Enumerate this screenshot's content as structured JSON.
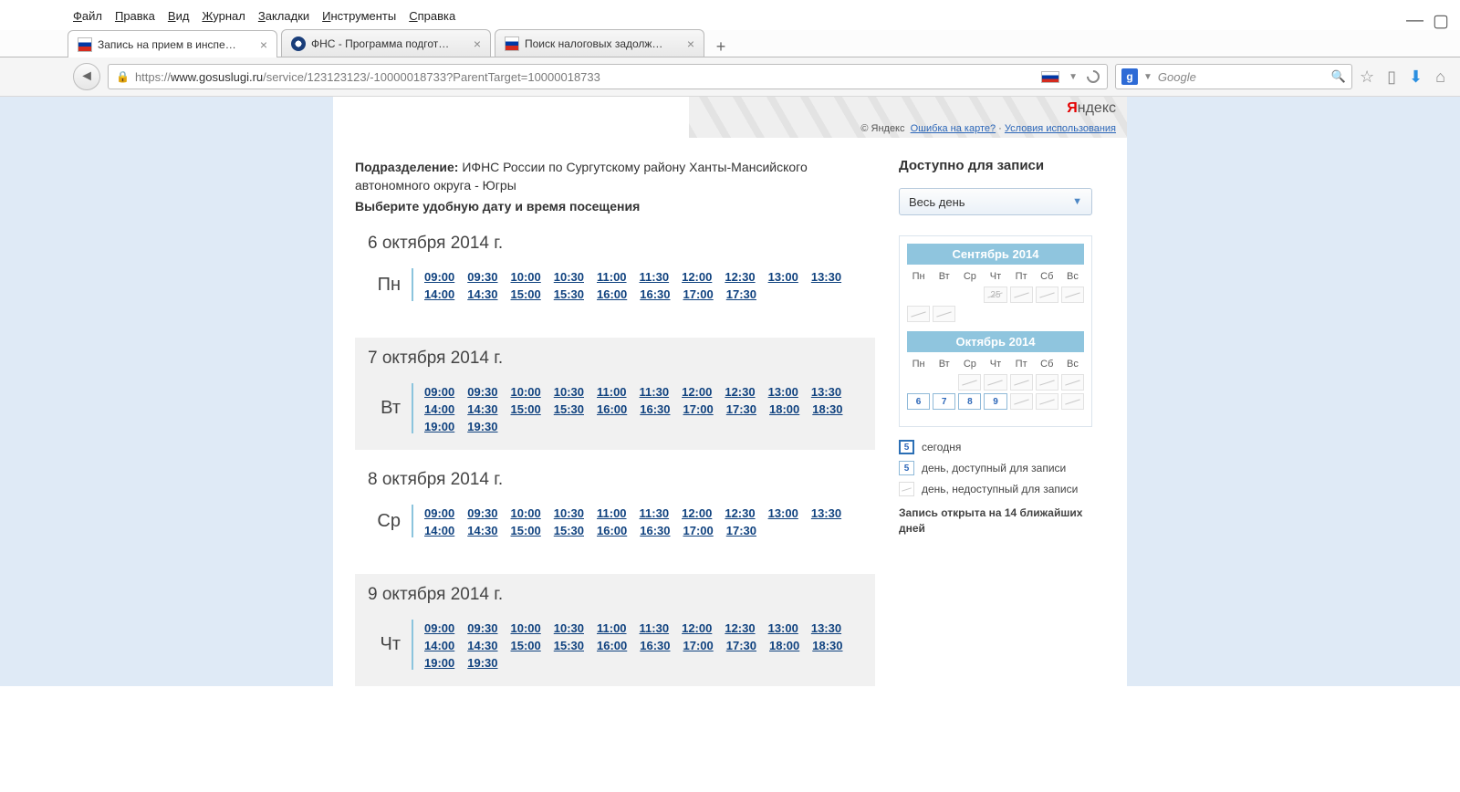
{
  "menubar": [
    "Файл",
    "Правка",
    "Вид",
    "Журнал",
    "Закладки",
    "Инструменты",
    "Справка"
  ],
  "tabs": [
    {
      "title": "Запись на прием в инспе…",
      "active": true,
      "icon": "flag-ru"
    },
    {
      "title": "ФНС - Программа подгот…",
      "active": false,
      "icon": "fns"
    },
    {
      "title": "Поиск налоговых задолж…",
      "active": false,
      "icon": "flag-ru"
    }
  ],
  "url": {
    "prefix": "https://",
    "domain": "www.gosuslugi.ru",
    "rest": "/service/123123123/-10000018733?ParentTarget=10000018733"
  },
  "search": {
    "engine": "Google",
    "placeholder": "Google"
  },
  "yandex": {
    "brand_y": "Я",
    "brand_rest": "ндекс",
    "copyright": "© Яндекс",
    "err": "Ошибка на карте?",
    "terms": "Условия использования"
  },
  "dept_label": "Подразделение:",
  "dept_value": "ИФНС России по Сургутскому району Ханты-Мансийского автономного округа - Югры",
  "instruct": "Выберите удобную дату и время посещения",
  "days": [
    {
      "title": "6 октября 2014 г.",
      "dow": "Пн",
      "alt": false,
      "slots": [
        "09:00",
        "09:30",
        "10:00",
        "10:30",
        "11:00",
        "11:30",
        "12:00",
        "12:30",
        "13:00",
        "13:30",
        "14:00",
        "14:30",
        "15:00",
        "15:30",
        "16:00",
        "16:30",
        "17:00",
        "17:30"
      ]
    },
    {
      "title": "7 октября 2014 г.",
      "dow": "Вт",
      "alt": true,
      "slots": [
        "09:00",
        "09:30",
        "10:00",
        "10:30",
        "11:00",
        "11:30",
        "12:00",
        "12:30",
        "13:00",
        "13:30",
        "14:00",
        "14:30",
        "15:00",
        "15:30",
        "16:00",
        "16:30",
        "17:00",
        "17:30",
        "18:00",
        "18:30",
        "19:00",
        "19:30"
      ]
    },
    {
      "title": "8 октября 2014 г.",
      "dow": "Ср",
      "alt": false,
      "slots": [
        "09:00",
        "09:30",
        "10:00",
        "10:30",
        "11:00",
        "11:30",
        "12:00",
        "12:30",
        "13:00",
        "13:30",
        "14:00",
        "14:30",
        "15:00",
        "15:30",
        "16:00",
        "16:30",
        "17:00",
        "17:30"
      ]
    },
    {
      "title": "9 октября 2014 г.",
      "dow": "Чт",
      "alt": true,
      "slots": [
        "09:00",
        "09:30",
        "10:00",
        "10:30",
        "11:00",
        "11:30",
        "12:00",
        "12:30",
        "13:00",
        "13:30",
        "14:00",
        "14:30",
        "15:00",
        "15:30",
        "16:00",
        "16:30",
        "17:00",
        "17:30",
        "18:00",
        "18:30",
        "19:00",
        "19:30"
      ]
    }
  ],
  "side": {
    "heading": "Доступно для записи",
    "dropdown": "Весь день",
    "dows": [
      "Пн",
      "Вт",
      "Ср",
      "Чт",
      "Пт",
      "Сб",
      "Вс"
    ],
    "months": [
      {
        "name": "Сентябрь 2014",
        "rows": [
          [
            null,
            null,
            null,
            {
              "n": "25",
              "t": "d"
            },
            {
              "n": "",
              "t": "d"
            },
            {
              "n": "",
              "t": "d"
            },
            {
              "n": "",
              "t": "d"
            }
          ],
          [
            {
              "n": "",
              "t": "d"
            },
            {
              "n": "",
              "t": "d"
            },
            null,
            null,
            null,
            null,
            null
          ]
        ]
      },
      {
        "name": "Октябрь 2014",
        "rows": [
          [
            null,
            null,
            {
              "n": "",
              "t": "d"
            },
            {
              "n": "",
              "t": "d"
            },
            {
              "n": "",
              "t": "d"
            },
            {
              "n": "",
              "t": "d"
            },
            {
              "n": "",
              "t": "d"
            }
          ],
          [
            {
              "n": "6",
              "t": "a"
            },
            {
              "n": "7",
              "t": "a"
            },
            {
              "n": "8",
              "t": "a"
            },
            {
              "n": "9",
              "t": "a"
            },
            {
              "n": "",
              "t": "d"
            },
            {
              "n": "",
              "t": "d"
            },
            {
              "n": "",
              "t": "d"
            }
          ]
        ]
      }
    ],
    "legend": {
      "today_n": "5",
      "today": "сегодня",
      "avail_n": "5",
      "avail": "день, доступный для записи",
      "dis_n": "",
      "dis": "день, недоступный для записи",
      "note": "Запись открыта на 14 ближайших дней"
    }
  }
}
